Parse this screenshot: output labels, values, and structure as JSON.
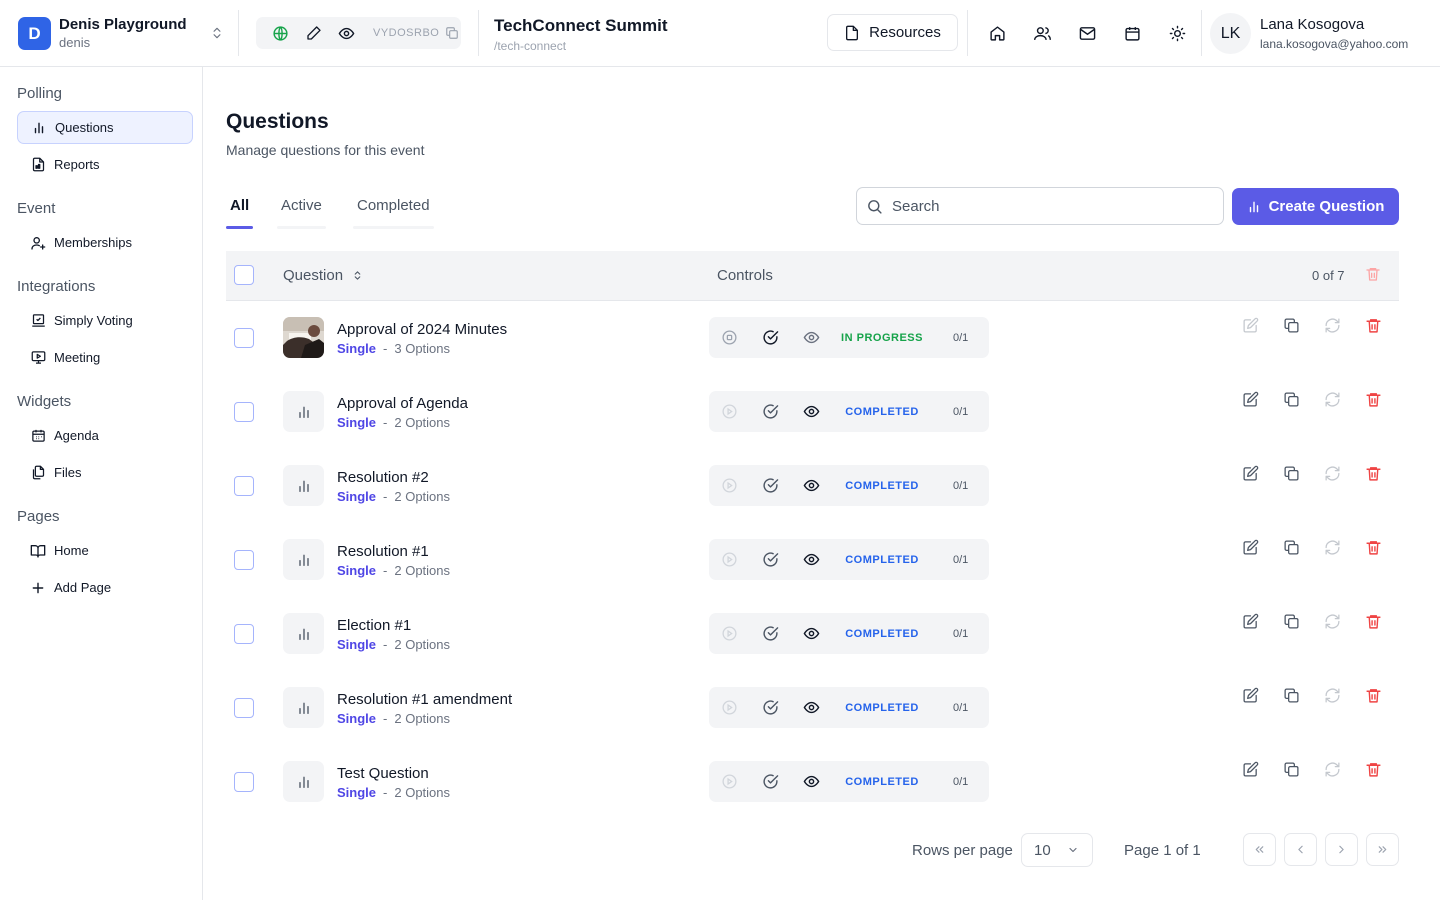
{
  "header": {
    "workspace": {
      "logo_letter": "D",
      "name": "Denis Playground",
      "sub": "denis"
    },
    "event_code": "VYDOSRBO",
    "event": {
      "title": "TechConnect Summit",
      "slug": "/tech-connect"
    },
    "resources_label": "Resources",
    "user": {
      "initials": "LK",
      "name": "Lana Kosogova",
      "email": "lana.kosogova@yahoo.com"
    }
  },
  "sidebar": {
    "sections": [
      {
        "title": "Polling",
        "items": [
          {
            "label": "Questions",
            "icon": "bar-chart-icon",
            "active": true
          },
          {
            "label": "Reports",
            "icon": "document-icon"
          }
        ]
      },
      {
        "title": "Event",
        "items": [
          {
            "label": "Memberships",
            "icon": "user-plus-icon"
          }
        ]
      },
      {
        "title": "Integrations",
        "items": [
          {
            "label": "Simply Voting",
            "icon": "ballot-icon"
          },
          {
            "label": "Meeting",
            "icon": "monitor-icon"
          }
        ]
      },
      {
        "title": "Widgets",
        "items": [
          {
            "label": "Agenda",
            "icon": "calendar-icon"
          },
          {
            "label": "Files",
            "icon": "files-icon"
          }
        ]
      },
      {
        "title": "Pages",
        "items": [
          {
            "label": "Home",
            "icon": "book-icon"
          },
          {
            "label": "Add Page",
            "icon": "plus-icon"
          }
        ]
      }
    ]
  },
  "main": {
    "title": "Questions",
    "subtitle": "Manage questions for this event",
    "tabs": [
      "All",
      "Active",
      "Completed"
    ],
    "search_placeholder": "Search",
    "create_label": "Create Question",
    "table": {
      "col_question": "Question",
      "col_controls": "Controls",
      "count": "0 of 7",
      "rows": [
        {
          "title": "Approval of 2024 Minutes",
          "type": "Single",
          "sep": "-",
          "options": "3 Options",
          "status": "IN PROGRESS",
          "votes": "0/1",
          "thumb": "photo"
        },
        {
          "title": "Approval of Agenda",
          "type": "Single",
          "sep": "-",
          "options": "2 Options",
          "status": "COMPLETED",
          "votes": "0/1",
          "thumb": "chart"
        },
        {
          "title": "Resolution #2",
          "type": "Single",
          "sep": "-",
          "options": "2 Options",
          "status": "COMPLETED",
          "votes": "0/1",
          "thumb": "chart"
        },
        {
          "title": "Resolution #1",
          "type": "Single",
          "sep": "-",
          "options": "2 Options",
          "status": "COMPLETED",
          "votes": "0/1",
          "thumb": "chart"
        },
        {
          "title": "Election #1",
          "type": "Single",
          "sep": "-",
          "options": "2 Options",
          "status": "COMPLETED",
          "votes": "0/1",
          "thumb": "chart"
        },
        {
          "title": "Resolution #1 amendment",
          "type": "Single",
          "sep": "-",
          "options": "2 Options",
          "status": "COMPLETED",
          "votes": "0/1",
          "thumb": "chart"
        },
        {
          "title": "Test Question",
          "type": "Single",
          "sep": "-",
          "options": "2 Options",
          "status": "COMPLETED",
          "votes": "0/1",
          "thumb": "chart"
        }
      ]
    },
    "pagination": {
      "rows_per_page_label": "Rows per page",
      "rows_per_page": "10",
      "page_info": "Page 1 of 1"
    }
  },
  "colors": {
    "accent": "#5b5be6",
    "brand": "#2f64e6",
    "danger": "#ef4444",
    "in_progress": "#16a34a",
    "completed": "#2563eb"
  }
}
